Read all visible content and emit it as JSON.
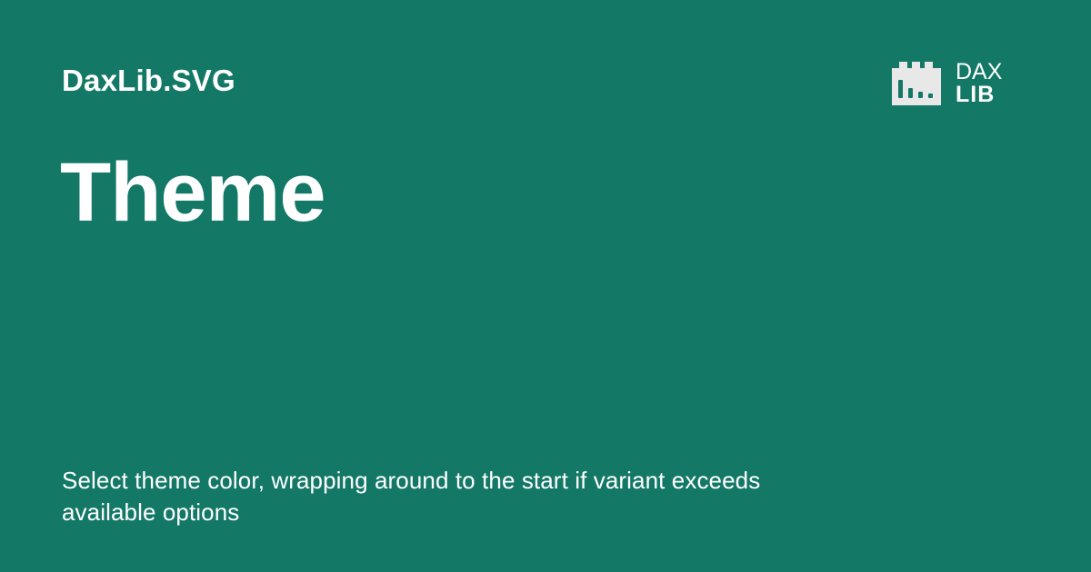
{
  "colors": {
    "background": "#137866",
    "text": "#ffffff",
    "logo_mark": "#e8e8e8",
    "logo_bar": "#137866"
  },
  "header": {
    "brand": "DaxLib.SVG"
  },
  "logo": {
    "icon": "dax-lib-logo-icon",
    "top_word": "DAX",
    "bottom_word": "LIB"
  },
  "main": {
    "title": "Theme",
    "description": "Select theme color, wrapping around to the start if variant exceeds available options"
  }
}
